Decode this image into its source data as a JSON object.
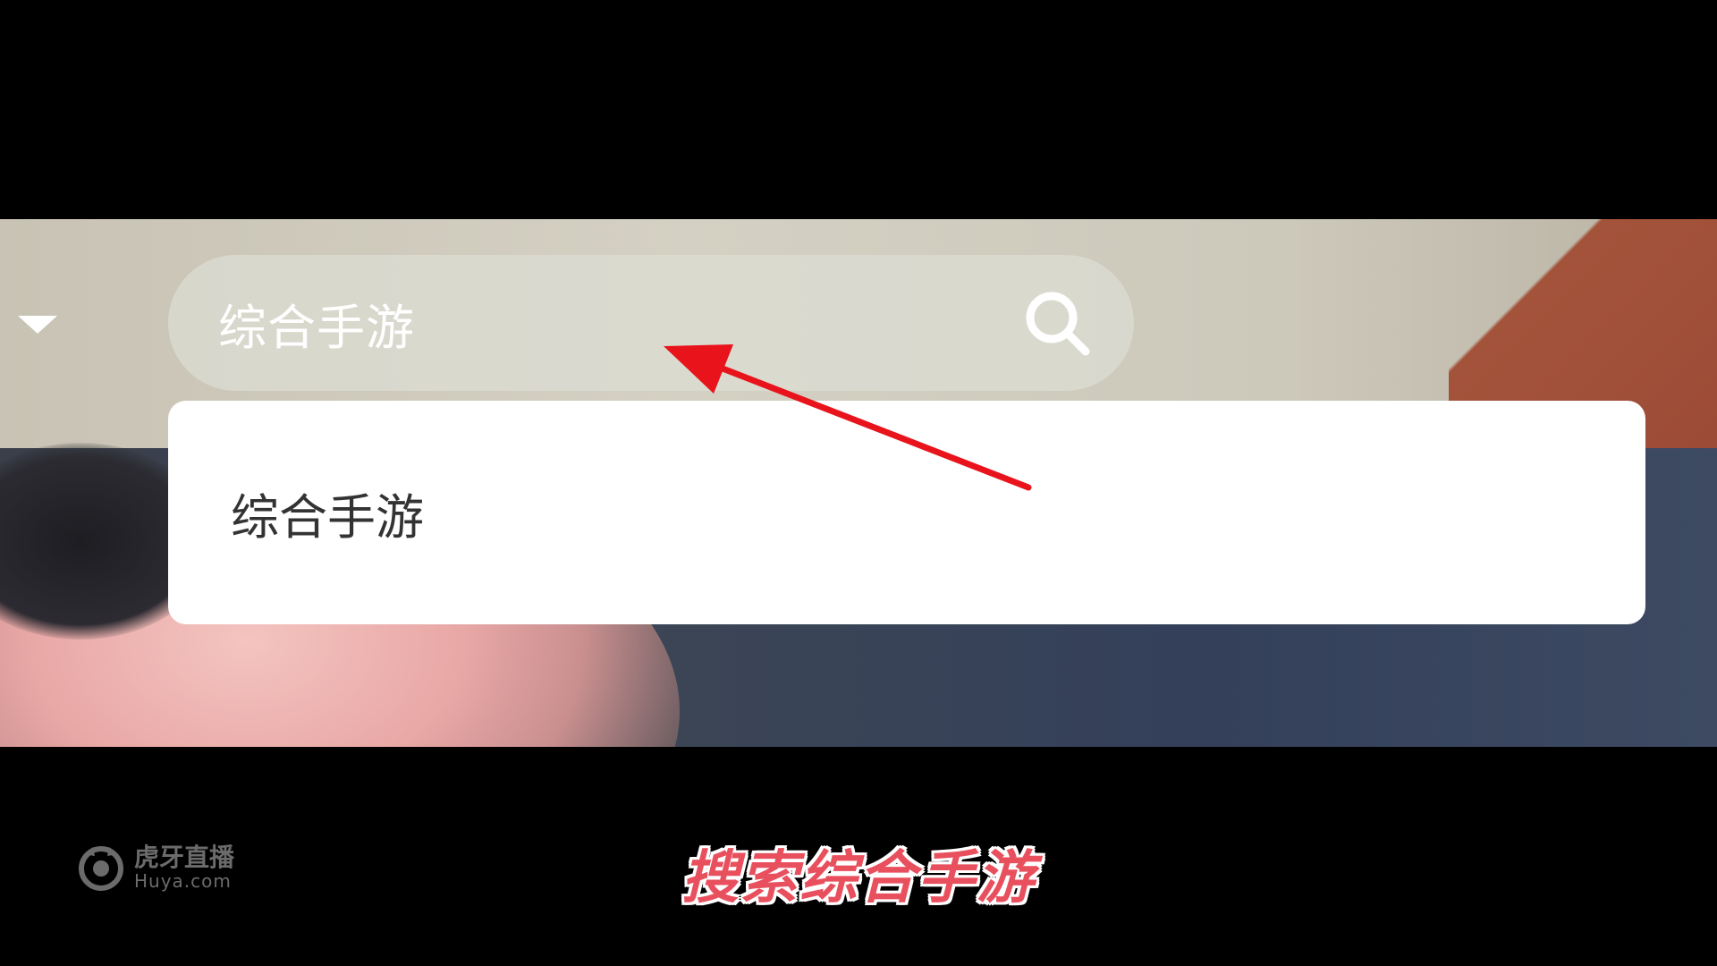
{
  "search": {
    "query": "综合手游",
    "icon": "search-icon"
  },
  "suggestions": [
    {
      "label": "综合手游"
    }
  ],
  "annotation": {
    "arrow_color": "#e8131b"
  },
  "watermark": {
    "brand_cn": "虎牙直播",
    "brand_en": "Huya.com"
  },
  "caption": {
    "text": "搜索综合手游",
    "color": "#e8505e"
  }
}
